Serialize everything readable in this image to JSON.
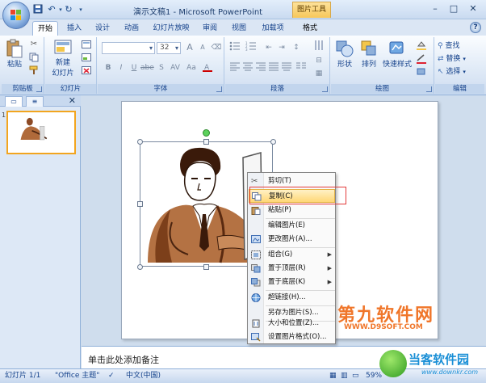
{
  "window": {
    "title": "演示文稿1 - Microsoft PowerPoint",
    "context_tab_title": "图片工具",
    "minimize": "–",
    "maximize": "□",
    "close": "✕"
  },
  "tabs": [
    {
      "label": "开始",
      "active": true
    },
    {
      "label": "插入"
    },
    {
      "label": "设计"
    },
    {
      "label": "动画"
    },
    {
      "label": "幻灯片放映"
    },
    {
      "label": "审阅"
    },
    {
      "label": "视图"
    },
    {
      "label": "加载项"
    },
    {
      "label": "格式"
    }
  ],
  "help_label": "?",
  "ribbon": {
    "clipboard": {
      "label": "剪贴板",
      "paste": "粘贴"
    },
    "slides": {
      "label": "幻灯片",
      "new_slide_line1": "新建",
      "new_slide_line2": "幻灯片"
    },
    "font": {
      "label": "字体",
      "font_size": "32",
      "bold": "B",
      "italic": "I",
      "underline": "U",
      "strike": "abe",
      "shadow": "S",
      "spacing": "AV",
      "case": "Aa",
      "grow": "A",
      "shrink": "A"
    },
    "paragraph": {
      "label": "段落"
    },
    "drawing": {
      "label": "绘图",
      "shapes": "形状",
      "arrange": "排列",
      "quick_styles": "快速样式"
    },
    "editing": {
      "label": "编辑",
      "find": "查找",
      "replace": "替换",
      "select": "选择"
    }
  },
  "side_panel": {
    "slide_number": "1"
  },
  "notes_placeholder": "单击此处添加备注",
  "statusbar": {
    "slide_info": "幻灯片 1/1",
    "theme": "\"Office 主题\"",
    "language": "中文(中国)",
    "zoom": "59%"
  },
  "context_menu": {
    "items": [
      {
        "label": "剪切(T)",
        "icon": "scissors-icon"
      },
      {
        "label": "复制(C)",
        "icon": "copy-icon",
        "highlighted": true
      },
      {
        "label": "粘贴(P)",
        "icon": "paste-icon"
      },
      {
        "label": "编辑图片(E)"
      },
      {
        "label": "更改图片(A)...",
        "icon": "change-picture-icon"
      },
      {
        "label": "组合(G)",
        "icon": "group-icon",
        "submenu": true
      },
      {
        "label": "置于顶层(R)",
        "icon": "bring-front-icon",
        "submenu": true
      },
      {
        "label": "置于底层(K)",
        "icon": "send-back-icon",
        "submenu": true
      },
      {
        "label": "超链接(H)...",
        "icon": "hyperlink-icon"
      },
      {
        "label": "另存为图片(S)..."
      },
      {
        "label": "大小和位置(Z)...",
        "icon": "size-position-icon"
      },
      {
        "label": "设置图片格式(O)...",
        "icon": "format-picture-icon"
      }
    ]
  },
  "watermarks": {
    "brand1": "第九软件网",
    "brand1_url": "WWW.D9SOFT.COM",
    "brand2": "当客软件园",
    "brand2_url": "www.downkr.com"
  },
  "colors": {
    "accent": "#15428b",
    "ribbon_bg": "#dfe9f5",
    "highlight": "#ffd776",
    "selection_frame": "#e23b3b",
    "thumb_border": "#f2a51f"
  }
}
